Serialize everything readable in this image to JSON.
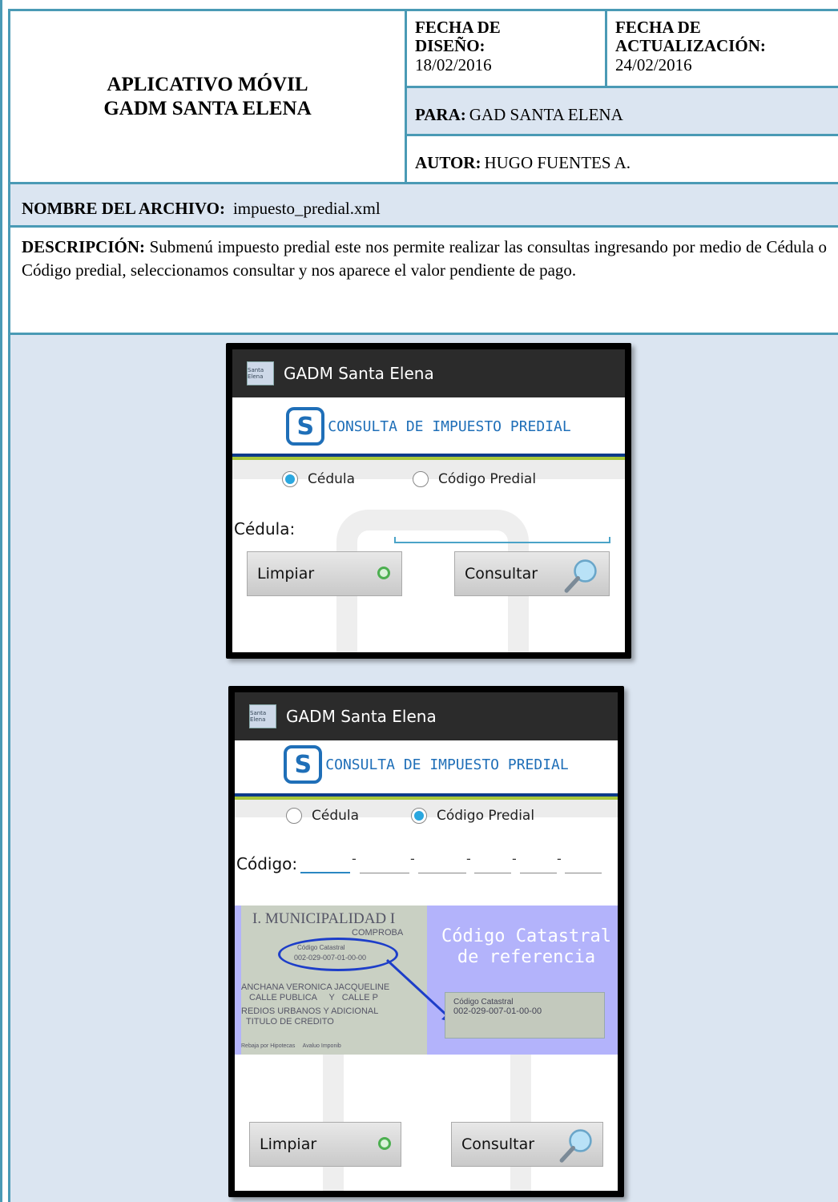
{
  "header": {
    "title_line1": "APLICATIVO MÓVIL",
    "title_line2": "GADM SANTA ELENA",
    "design_label_line1": "FECHA DE",
    "design_label_line2": "DISEÑO:",
    "design_date": "18/02/2016",
    "update_label_line1": "FECHA DE",
    "update_label_line2": "ACTUALIZACIÓN:",
    "update_date": "24/02/2016",
    "para_label": "PARA:",
    "para_value": "GAD SANTA ELENA",
    "autor_label": "AUTOR:",
    "autor_value": "HUGO FUENTES A."
  },
  "file": {
    "label": "NOMBRE DEL ARCHIVO:",
    "value": "impuesto_predial.xml"
  },
  "description": {
    "label": "DESCRIPCIÓN:",
    "text": "Submenú impuesto predial este nos permite realizar las consultas ingresando por medio de Cédula o Código predial, seleccionamos consultar y nos aparece el valor pendiente de pago."
  },
  "screens": {
    "app_title": "GADM Santa Elena",
    "app_icon_text": "Santa Elena",
    "banner_text": "CONSULTA DE IMPUESTO PREDIAL",
    "radio_cedula": "Cédula",
    "radio_codigo": "Código Predial",
    "screen1": {
      "selected": "Cédula",
      "field_label": "Cédula:",
      "clear_button": "Limpiar",
      "query_button": "Consultar"
    },
    "screen2": {
      "selected": "Código Predial",
      "field_label": "Código:",
      "separator": "-",
      "ref_doc_line1": "I. MUNICIPALIDAD I",
      "ref_doc_line2": "COMPROBA",
      "ref_doc_code_label": "Código Catastral",
      "ref_doc_code": "002-029-007-01-00-00",
      "ref_doc_name": "ANCHANA VERONICA JACQUELINE",
      "ref_doc_street": "CALLE PUBLICA     Y   CALLE P",
      "ref_doc_line3": "REDIOS URBANOS Y ADICIONAL",
      "ref_doc_line4": "TITULO DE CREDITO",
      "ref_doc_footer": "Rebaja por Hipotecas     Avaluo Imponib",
      "ref_title_line1": "Código Catastral",
      "ref_title_line2": "de referencia",
      "ref_snip_label": "Código Catastral",
      "ref_snip_code": "002-029-007-01-00-00",
      "clear_button": "Limpiar",
      "query_button": "Consultar"
    }
  }
}
